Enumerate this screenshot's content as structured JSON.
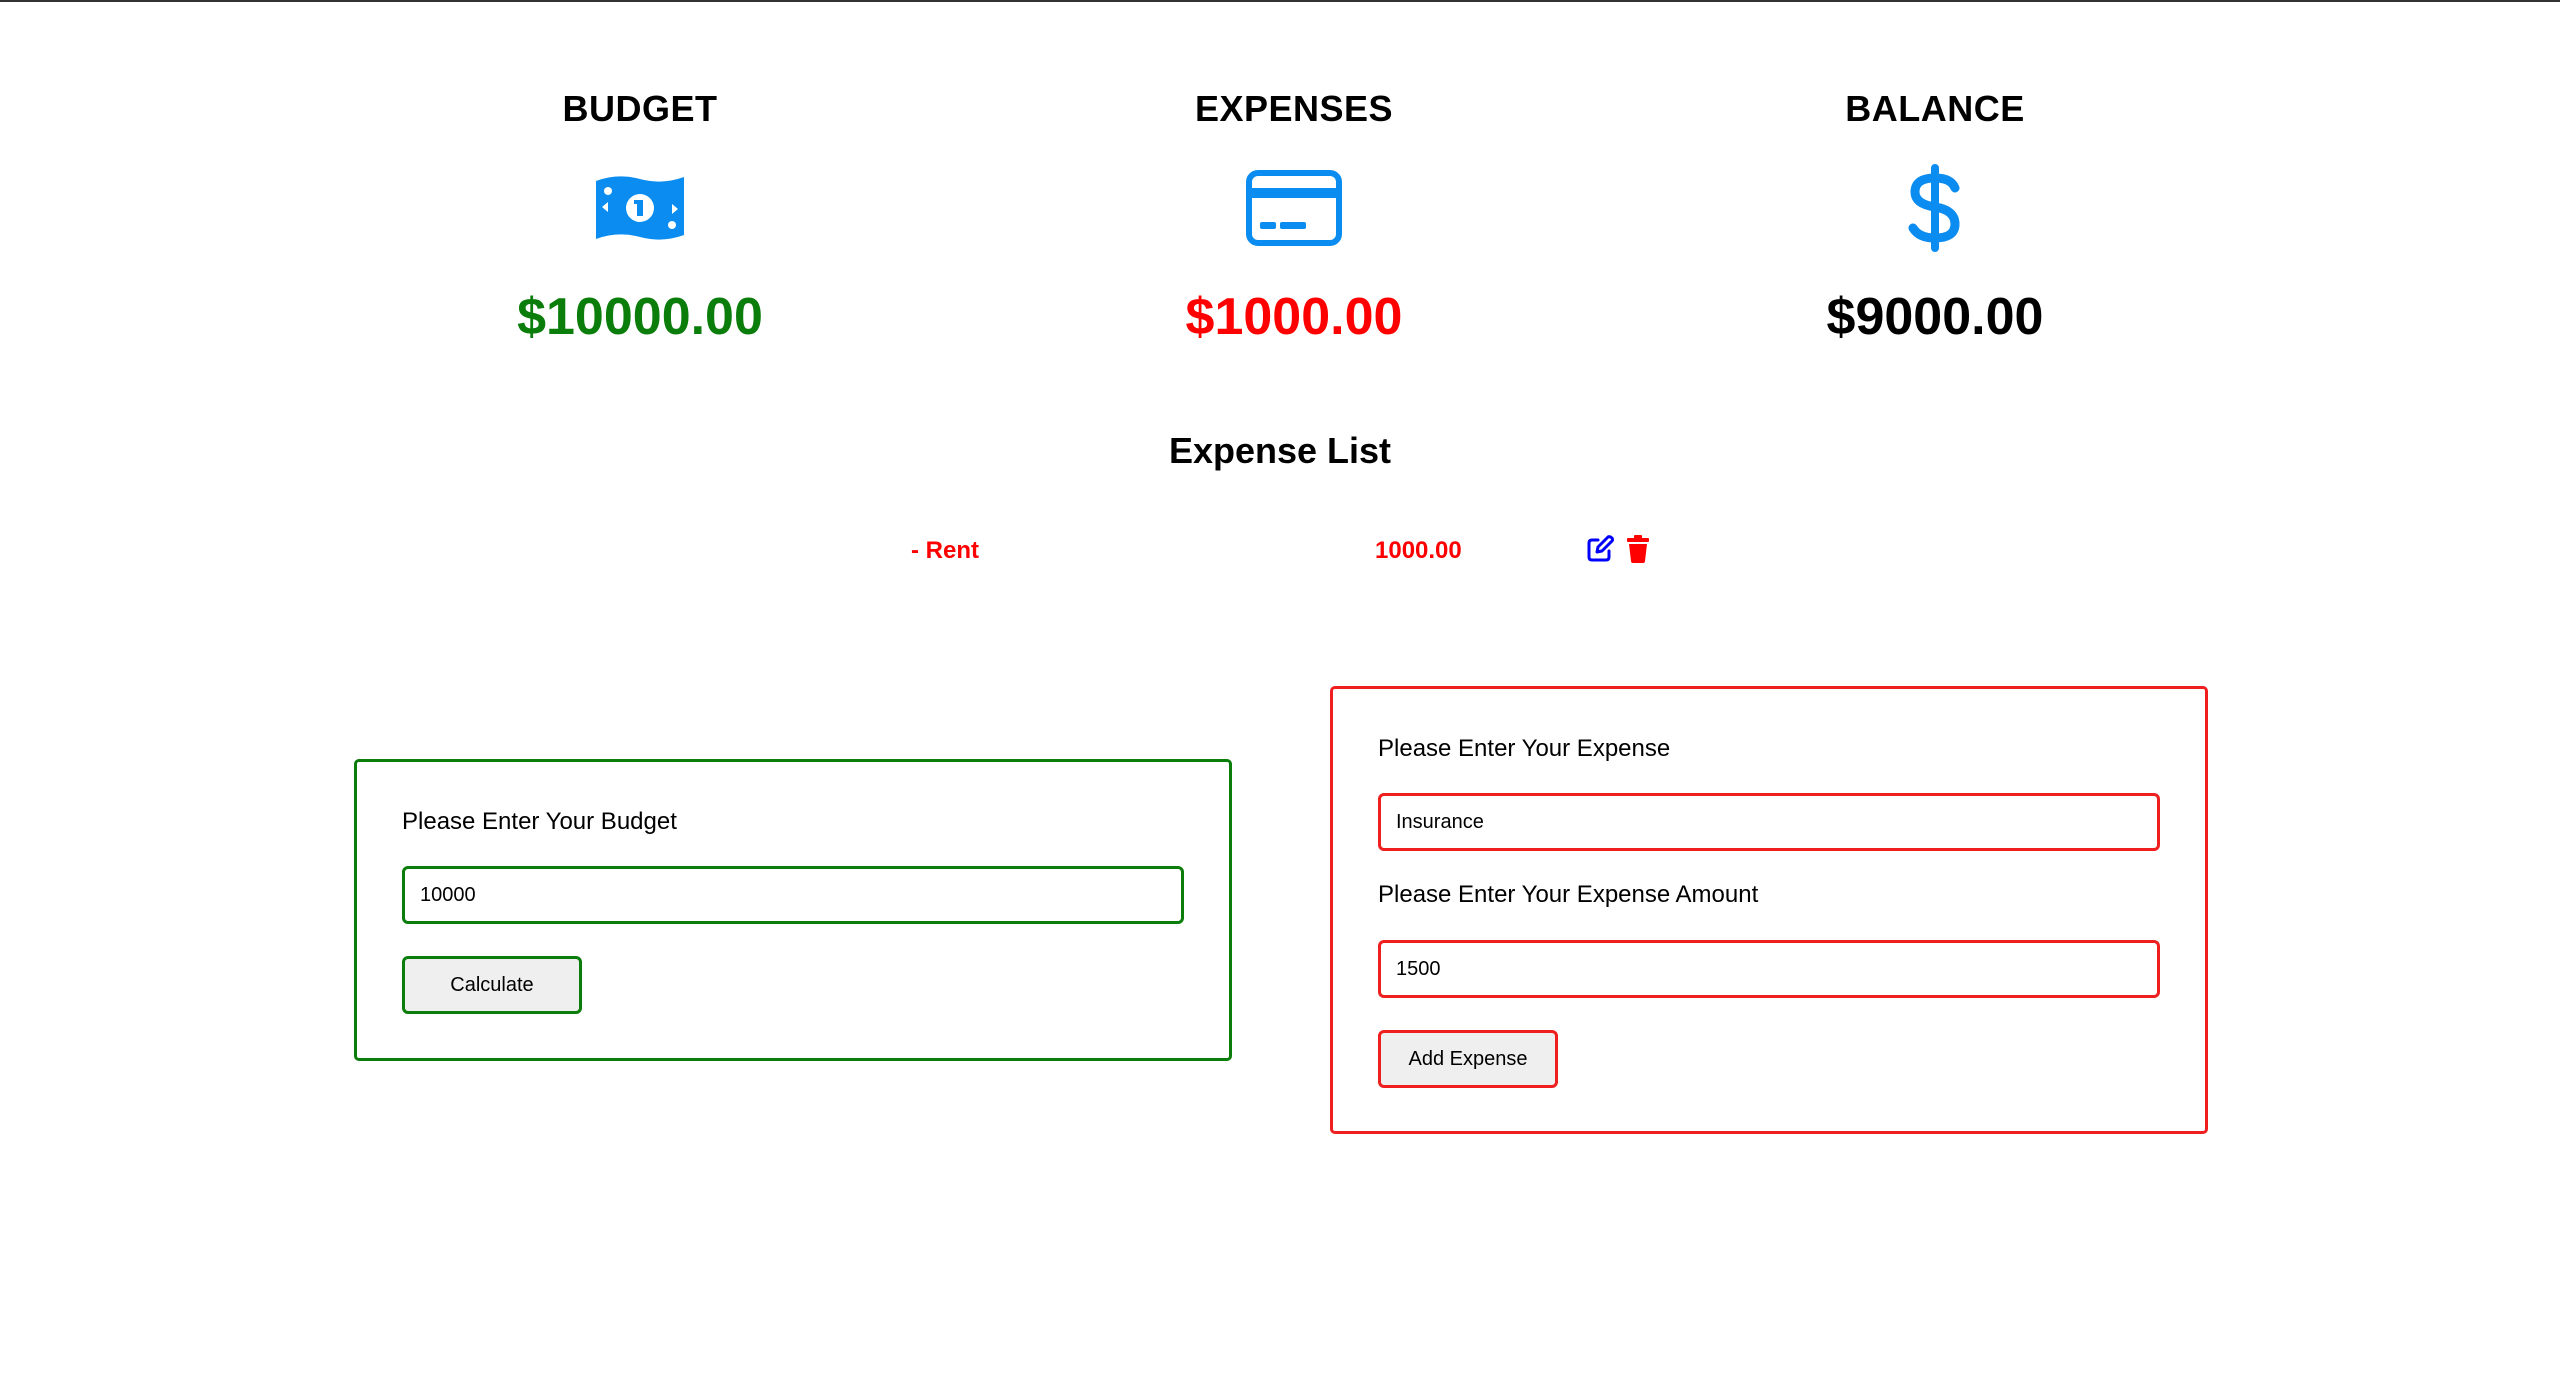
{
  "summary": {
    "budget": {
      "title": "BUDGET",
      "icon": "money-bill-icon",
      "value": "$10000.00",
      "color": "#0a7d0a"
    },
    "expenses": {
      "title": "EXPENSES",
      "icon": "credit-card-icon",
      "value": "$1000.00",
      "color": "#ff0000"
    },
    "balance": {
      "title": "BALANCE",
      "icon": "dollar-sign-icon",
      "value": "$9000.00",
      "color": "#000000"
    }
  },
  "icon_color": "#0a8cf0",
  "expense_list": {
    "title": "Expense List",
    "items": [
      {
        "name": "- Rent",
        "amount": "1000.00",
        "edit_icon": "edit-icon",
        "delete_icon": "trash-icon"
      }
    ]
  },
  "budget_form": {
    "label": "Please Enter Your Budget",
    "input_value": "10000",
    "button_label": "Calculate"
  },
  "expense_form": {
    "name_label": "Please Enter Your Expense",
    "name_value": "Insurance",
    "amount_label": "Please Enter Your Expense Amount",
    "amount_value": "1500",
    "button_label": "Add Expense"
  }
}
